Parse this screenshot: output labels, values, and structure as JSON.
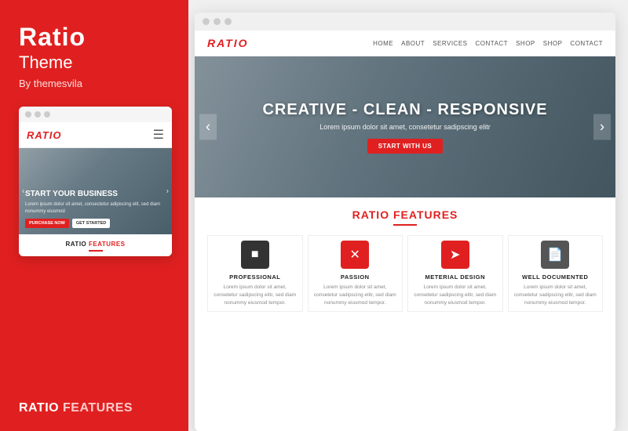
{
  "left": {
    "title": "Ratio",
    "subtitle": "Theme",
    "author": "By themesvila",
    "mobile": {
      "dots": [
        "",
        "",
        ""
      ],
      "logo": "RATIO",
      "hero_title": "START YOUR BUSINESS",
      "hero_text": "Lorem ipsum dolor sit amet, consectetur\nadipiscing elit, sed diam nonummy eiusmod",
      "btn_primary": "PURCHASE NOW",
      "btn_secondary": "GET\nSTARTED"
    },
    "bottom_features": "RATIO FEATURES"
  },
  "right": {
    "browser": {
      "logo": "RATIO",
      "nav_links": [
        "HOME",
        "ABOUT",
        "SERVICES",
        "CONTACT",
        "SHOP",
        "SHOP",
        "CONTACT"
      ],
      "hero": {
        "title": "CREATIVE - CLEAN - RESPONSIVE",
        "subtitle": "Lorem ipsum dolor sit amet, consetetur sadipscing elitr",
        "btn": "START WITH US"
      },
      "features_title": "RATIO",
      "features_title_colored": "FEATURES",
      "features": [
        {
          "icon": "■",
          "name": "PROFESSIONAL",
          "desc": "Lorem ipsum dolor sit amet, consetetur sadipscing elitr, sed diam nonummy eiusmod tempor."
        },
        {
          "icon": "✕",
          "name": "PASSION",
          "desc": "Lorem ipsum dolor sit amet, consetetur sadipscing elitr, sed diam nonummy eiusmod tempor."
        },
        {
          "icon": "➤",
          "name": "METERIAL DESIGN",
          "desc": "Lorem ipsum dolor sit amet, consetetur sadipscing elitr, sed diam nonummy eiusmod tempor."
        },
        {
          "icon": "📄",
          "name": "WELL DOCUMENTED",
          "desc": "Lorem ipsum dolor sit amet, consetetur sadipscing elitr, sed diam nonummy eiusmod tempor."
        }
      ]
    }
  }
}
